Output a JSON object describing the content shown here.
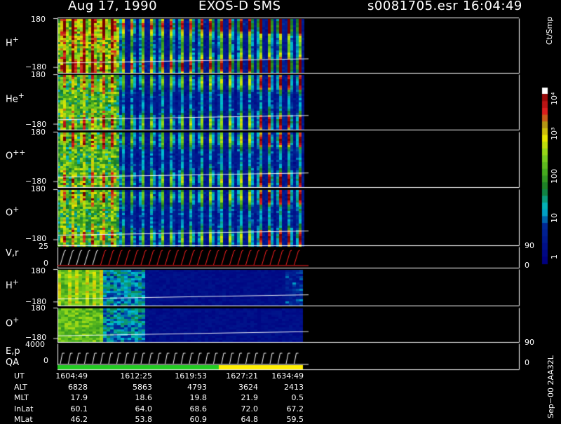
{
  "header": {
    "date": "Aug 17, 1990",
    "instrument": "EXOS-D SMS",
    "file": "s0081705.esr",
    "time": "16:04:49"
  },
  "colors": {
    "background": "#000000",
    "foreground": "#ffffff",
    "low_counts": "#000080",
    "high_counts": "#8b0000",
    "pitch_trace": "#ff2020",
    "qa_bar": "#22cc22",
    "qa_bar_alt": "#ffee00"
  },
  "chart_data": {
    "type": "heatmap",
    "panels": [
      {
        "label": "H",
        "superscript": "+",
        "y_top": "180",
        "y_bottom": "−180"
      },
      {
        "label": "He",
        "superscript": "+",
        "y_top": "180",
        "y_bottom": "−180"
      },
      {
        "label": "O",
        "superscript": "++",
        "y_top": "180",
        "y_bottom": "−180"
      },
      {
        "label": "O",
        "superscript": "+",
        "y_top": "180",
        "y_bottom": "−180"
      },
      {
        "label": "V,r",
        "superscript": "",
        "y_top": "25",
        "y_bottom": "0",
        "right_top": "90",
        "right_bottom": "0"
      },
      {
        "label": "H",
        "superscript": "+",
        "y_top": "180",
        "y_bottom": "−180"
      },
      {
        "label": "O",
        "superscript": "+",
        "y_top": "180",
        "y_bottom": "−180"
      },
      {
        "label": "E,p",
        "label2": "QA",
        "superscript": "",
        "y_top": "4000",
        "y_bottom": "0",
        "right_top": "90",
        "right_bottom": "0"
      }
    ],
    "colorbar": {
      "title": "Ct/Smp",
      "scale": "log",
      "range": [
        1,
        10000
      ],
      "tick_labels": [
        "1",
        "10",
        "100",
        "10³",
        "10⁴"
      ],
      "tick_values": [
        1,
        10,
        100,
        1000,
        10000
      ]
    },
    "x_axis": {
      "tick_labels": [
        "1604:49",
        "1612:25",
        "1619:53",
        "1627:21",
        "1634:49"
      ]
    },
    "ephemeris": {
      "rows": [
        {
          "label": "UT",
          "values": [
            "1604:49",
            "1612:25",
            "1619:53",
            "1627:21",
            "1634:49"
          ]
        },
        {
          "label": "ALT",
          "values": [
            "6828",
            "5863",
            "4793",
            "3624",
            "2413"
          ]
        },
        {
          "label": "MLT",
          "values": [
            "17.9",
            "18.6",
            "19.8",
            "21.9",
            "0.5"
          ]
        },
        {
          "label": "InLat",
          "values": [
            "60.1",
            "64.0",
            "68.6",
            "72.0",
            "67.2"
          ]
        },
        {
          "label": "MLat",
          "values": [
            "46.2",
            "53.8",
            "60.9",
            "64.8",
            "59.5"
          ]
        }
      ]
    },
    "footer_tag": "Sep−00  2AA32L"
  }
}
